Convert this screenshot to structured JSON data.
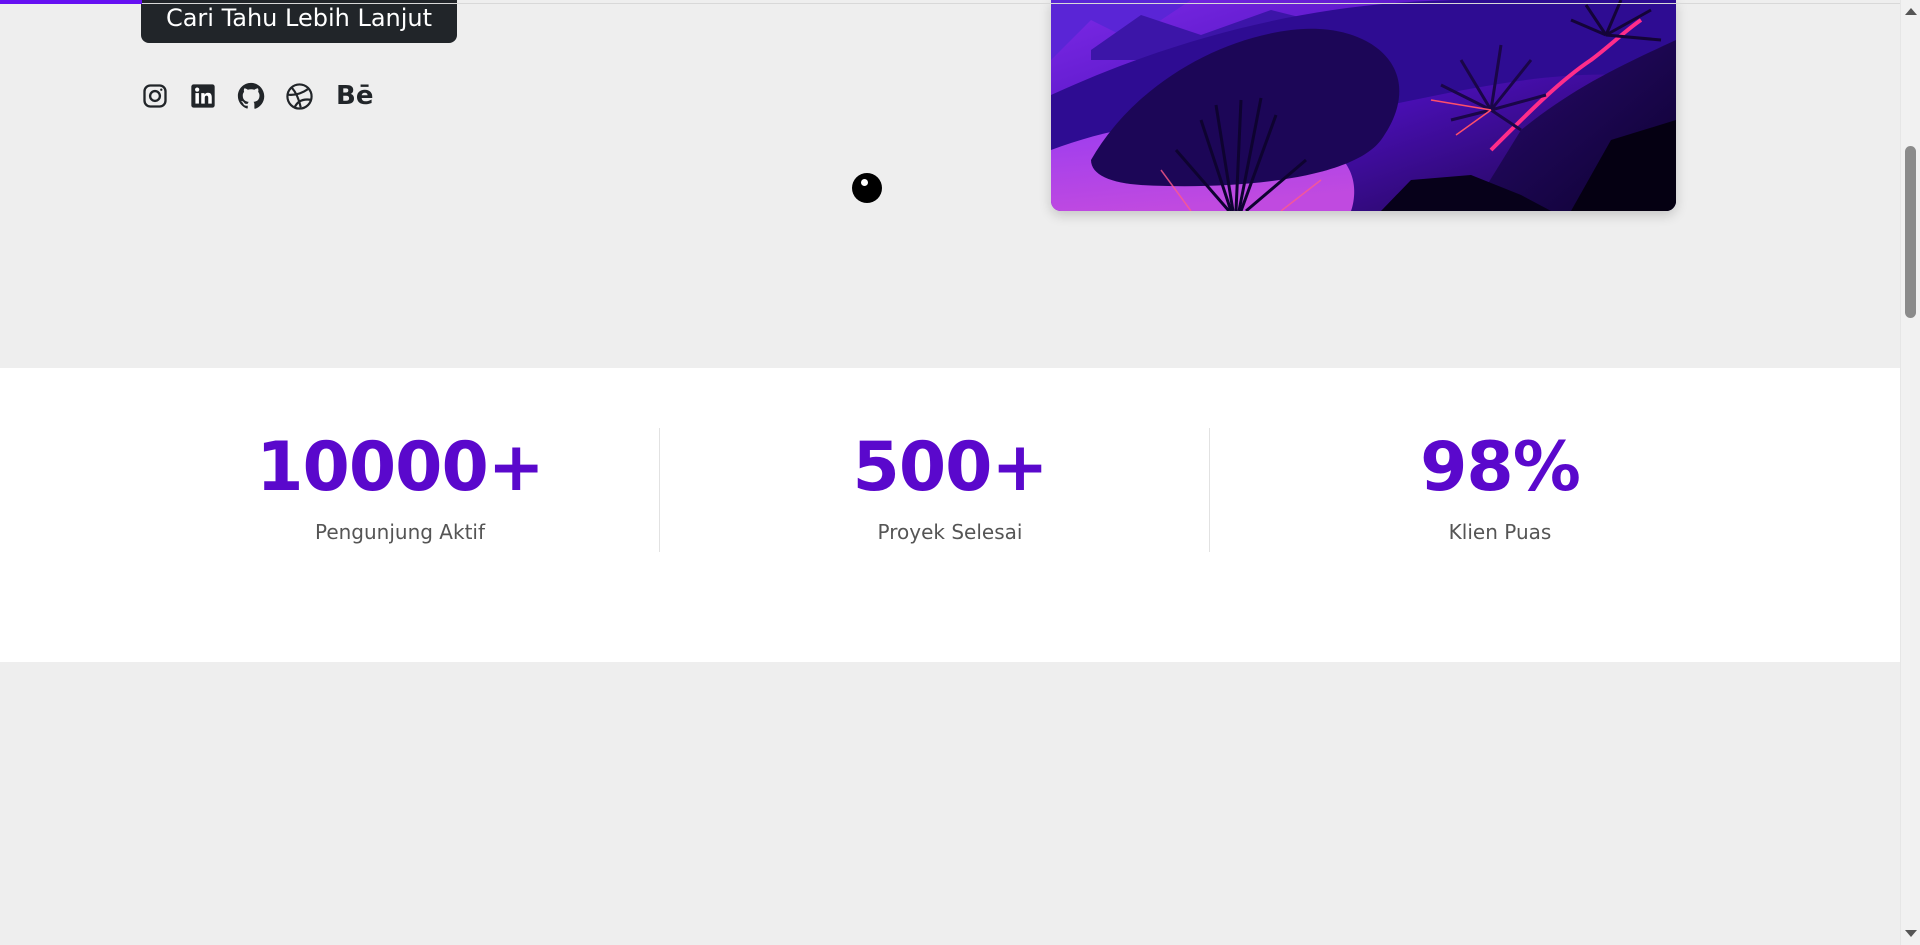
{
  "hero": {
    "cta_label": "Cari Tahu Lebih Lanjut",
    "socials": [
      {
        "icon": "instagram-icon"
      },
      {
        "icon": "linkedin-icon"
      },
      {
        "icon": "github-icon"
      },
      {
        "icon": "dribbble-icon"
      },
      {
        "icon": "behance-icon",
        "label": "Bē"
      }
    ]
  },
  "stats": [
    {
      "value": "10000+",
      "label": "Pengunjung Aktif"
    },
    {
      "value": "500+",
      "label": "Proyek Selesai"
    },
    {
      "value": "98%",
      "label": "Klien Puas"
    }
  ],
  "colors": {
    "accent": "#5a08cc",
    "progress": "#6610f2",
    "button_bg": "#212529",
    "page_bg": "#eeeeee",
    "stats_bg": "#ffffff"
  }
}
